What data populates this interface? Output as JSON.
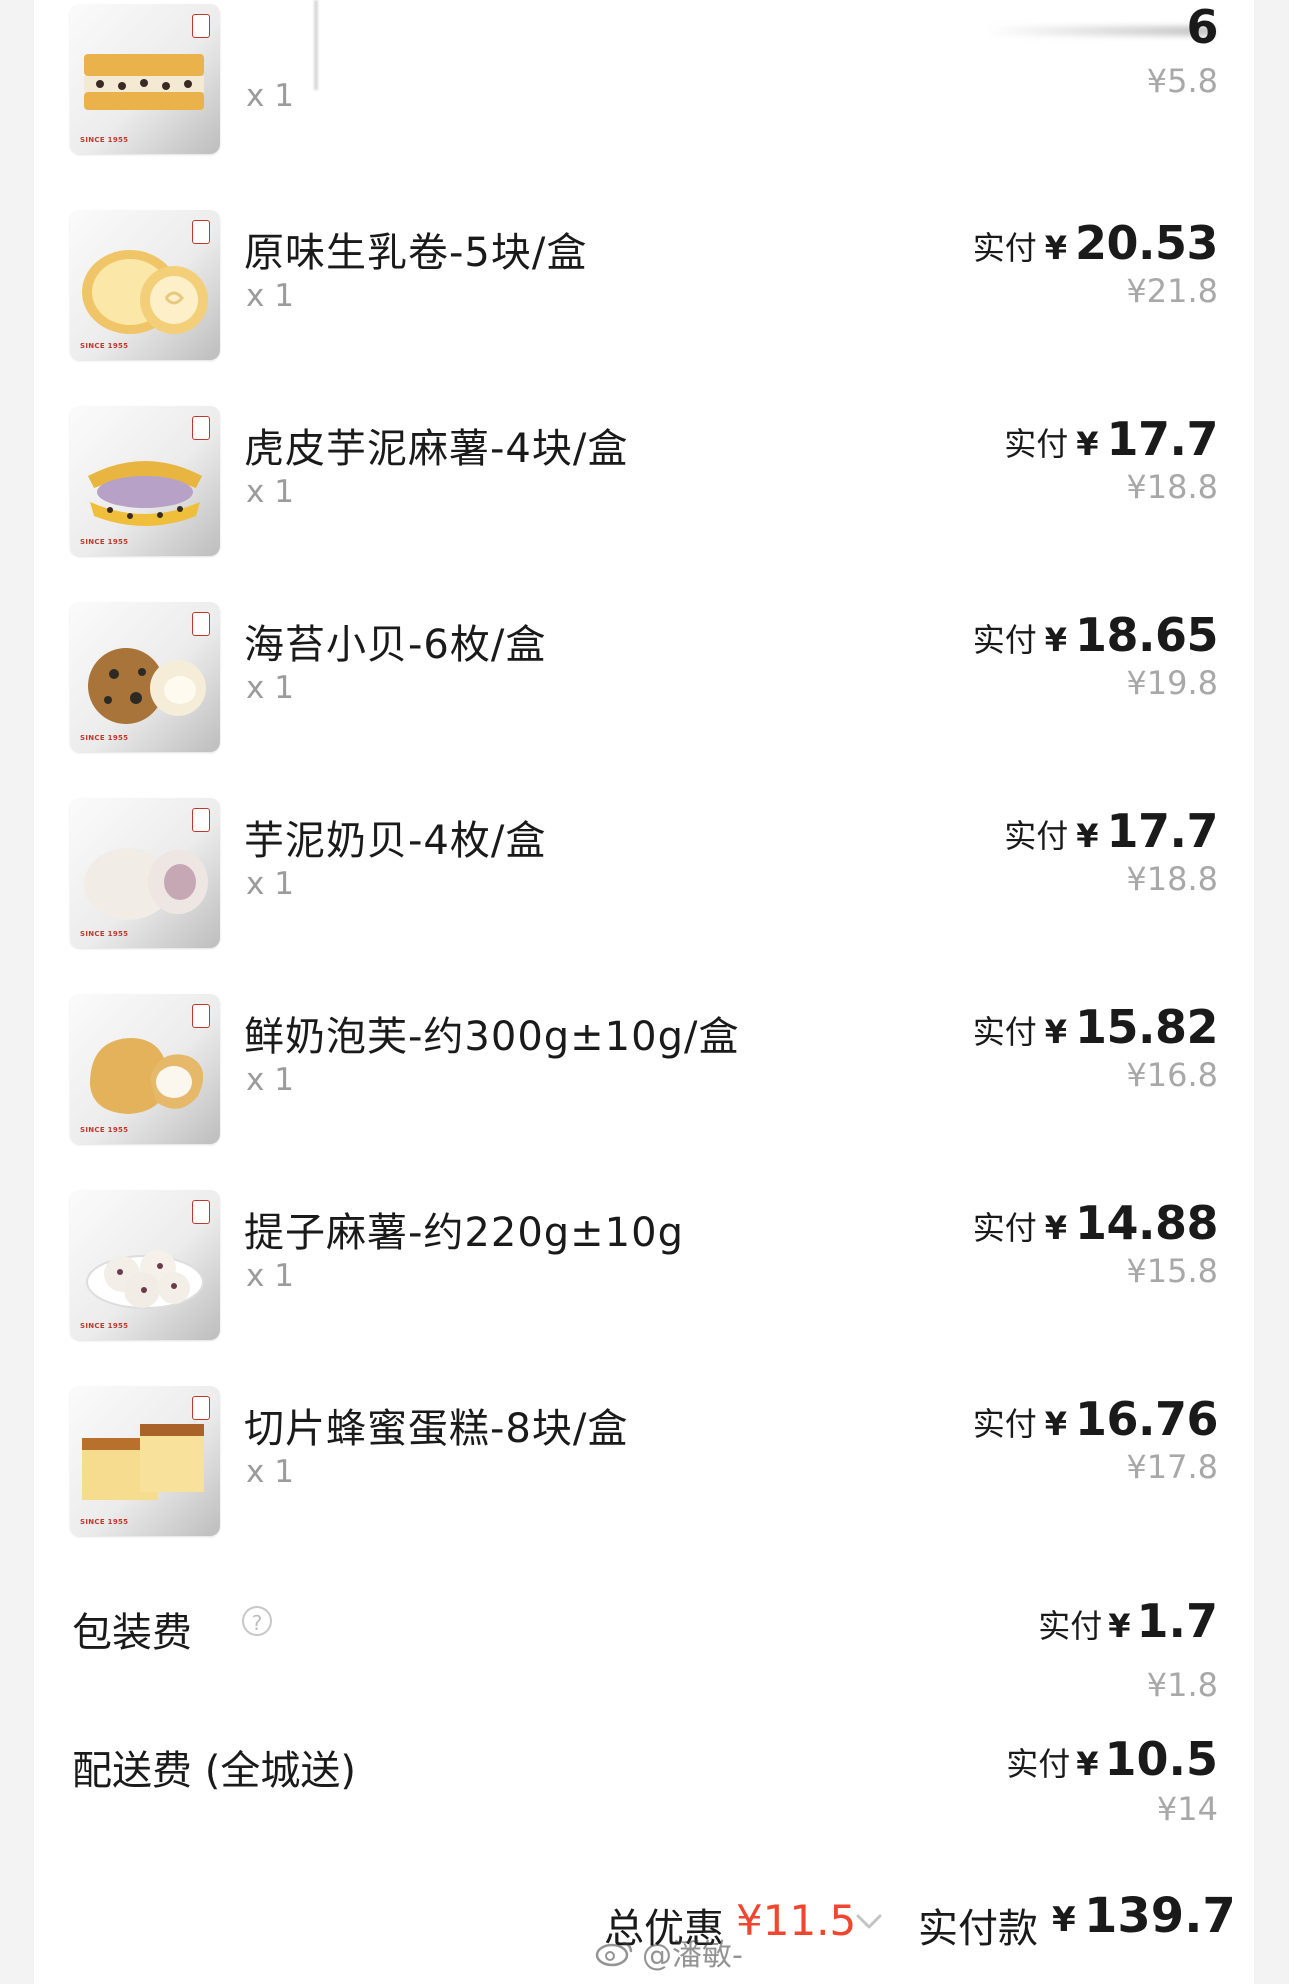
{
  "items": [
    {
      "name": "",
      "qty": "x 1",
      "paid_label": "",
      "currency": "",
      "paid": "6",
      "original": "¥5.8"
    },
    {
      "name": "原味生乳卷-5块/盒",
      "qty": "x 1",
      "paid_label": "实付",
      "currency": "¥",
      "paid": "20.53",
      "original": "¥21.8"
    },
    {
      "name": "虎皮芋泥麻薯-4块/盒",
      "qty": "x 1",
      "paid_label": "实付",
      "currency": "¥",
      "paid": "17.7",
      "original": "¥18.8"
    },
    {
      "name": "海苔小贝-6枚/盒",
      "qty": "x 1",
      "paid_label": "实付",
      "currency": "¥",
      "paid": "18.65",
      "original": "¥19.8"
    },
    {
      "name": "芋泥奶贝-4枚/盒",
      "qty": "x 1",
      "paid_label": "实付",
      "currency": "¥",
      "paid": "17.7",
      "original": "¥18.8"
    },
    {
      "name": "鲜奶泡芙-约300g±10g/盒",
      "qty": "x 1",
      "paid_label": "实付",
      "currency": "¥",
      "paid": "15.82",
      "original": "¥16.8"
    },
    {
      "name": "提子麻薯-约220g±10g",
      "qty": "x 1",
      "paid_label": "实付",
      "currency": "¥",
      "paid": "14.88",
      "original": "¥15.8"
    },
    {
      "name": "切片蜂蜜蛋糕-8块/盒",
      "qty": "x 1",
      "paid_label": "实付",
      "currency": "¥",
      "paid": "16.76",
      "original": "¥17.8"
    }
  ],
  "thumb_caption": "SINCE 1955",
  "fees": [
    {
      "name": "包装费",
      "has_help": true,
      "help_icon": "question-circle-icon",
      "paid_label": "实付",
      "currency": "¥",
      "paid": "1.7",
      "original": "¥1.8"
    },
    {
      "name": "配送费 (全城送)",
      "has_help": false,
      "paid_label": "实付",
      "currency": "¥",
      "paid": "10.5",
      "original": "¥14"
    }
  ],
  "footer": {
    "discount_label": "总优惠",
    "discount_amount": "¥11.5",
    "total_label": "实付款",
    "total_currency": "¥",
    "total_amount": "139.7"
  },
  "watermark": {
    "icon": "weibo-icon",
    "text": "@潘敏-"
  },
  "colors": {
    "accent": "#f0452f",
    "muted": "#a8a8a8",
    "text": "#1a1a1a",
    "brand_red": "#c0392b"
  }
}
